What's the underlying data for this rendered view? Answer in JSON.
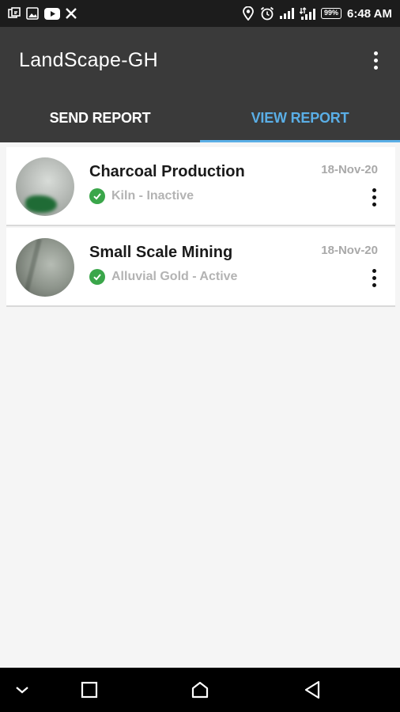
{
  "status_bar": {
    "time": "6:48 AM",
    "battery": "99%",
    "left_icons": [
      "notification-icon",
      "image-icon",
      "youtube-icon",
      "x-icon"
    ],
    "right_icons": [
      "location-icon",
      "alarm-icon",
      "signal-icon",
      "signal-data-icon",
      "battery-icon"
    ]
  },
  "app_bar": {
    "title": "LandScape-GH"
  },
  "tabs": [
    {
      "label": "SEND REPORT",
      "active": false
    },
    {
      "label": "VIEW REPORT",
      "active": true
    }
  ],
  "colors": {
    "accent": "#5aaee6",
    "app_bar": "#3a3a3a",
    "check": "#3aa64a"
  },
  "reports": [
    {
      "title": "Charcoal Production",
      "subtitle": "Kiln - Inactive",
      "date": "18-Nov-20"
    },
    {
      "title": "Small Scale Mining",
      "subtitle": "Alluvial Gold - Active",
      "date": "18-Nov-20"
    }
  ],
  "nav_bar": {
    "buttons": [
      "chevron-down-icon",
      "recent-apps-icon",
      "home-icon",
      "back-icon"
    ]
  }
}
